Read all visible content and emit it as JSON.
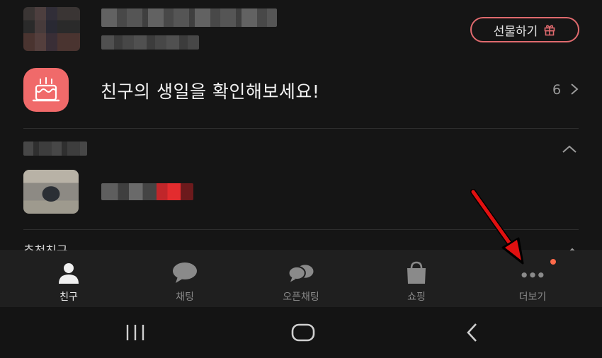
{
  "profile": {
    "gift_button_label": "선물하기",
    "gift_icon": "gift-icon"
  },
  "birthday": {
    "text": "친구의 생일을 확인해보세요!",
    "count": "6",
    "icon": "cake-icon",
    "accent": "#f06a6a"
  },
  "recommended": {
    "header": "추천친구"
  },
  "tabs": [
    {
      "label": "친구",
      "icon": "person-icon",
      "active": true
    },
    {
      "label": "채팅",
      "icon": "chat-bubble-icon",
      "active": false
    },
    {
      "label": "오픈채팅",
      "icon": "open-chat-icon",
      "active": false
    },
    {
      "label": "쇼핑",
      "icon": "shopping-bag-icon",
      "active": false
    },
    {
      "label": "더보기",
      "icon": "more-dots-icon",
      "active": false,
      "badge": true
    }
  ],
  "system_nav": {
    "recents": "recents-icon",
    "home": "home-icon",
    "back": "back-icon"
  },
  "colors": {
    "background": "#151515",
    "tabbar": "#1f1f1f",
    "gift_border": "#e06a6e",
    "badge": "#ff6a4a",
    "annotation_arrow": "#e01010"
  }
}
